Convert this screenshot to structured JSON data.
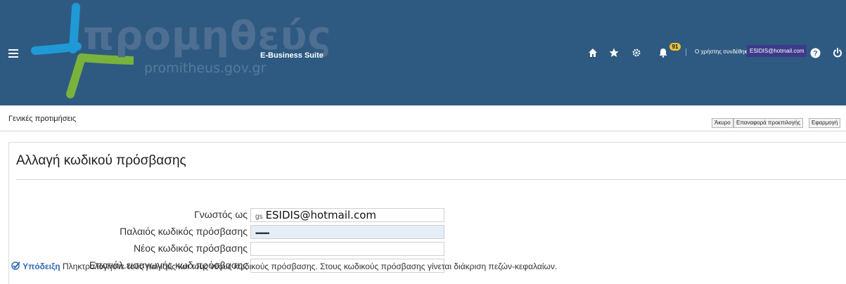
{
  "header": {
    "logo_text": "προμηθεύς",
    "logo_subtitle": "promitheus.gov.gr",
    "suite_name": "E-Business Suite",
    "notification_count": "91",
    "user_label": "Ο χρήστης συνδέθηκε",
    "user_email": "ESIDIS@hotmail.com",
    "separator": "|",
    "icons": [
      "menu-icon",
      "home-icon",
      "star-icon",
      "gear-icon",
      "bell-icon",
      "help-icon",
      "power-icon"
    ],
    "colors": {
      "header_bg": "#2e5a82",
      "logo_blue": "#1f9ad6",
      "logo_green": "#7ab33b",
      "badge": "#e6c43a"
    }
  },
  "subbar": {
    "title": "Γενικές προτιμήσεις",
    "cancel_label": "Άκυρο",
    "reset_label": "Επαναφορά προεπιλογής",
    "apply_label": "Εφαρμογή"
  },
  "form": {
    "title": "Αλλαγή κωδικού πρόσβασης",
    "fields": [
      {
        "label": "Γνωστός ως",
        "prefix": "gs",
        "value": "ESIDIS@hotmail.com"
      },
      {
        "label": "Παλαιός κωδικός πρόσβασης",
        "value": "•••••••••"
      },
      {
        "label": "Νέος κωδικός πρόσβασης",
        "value": ""
      },
      {
        "label": "Επανάλ.εισαγωγής κωδ.πρόσβασης",
        "value": ""
      }
    ],
    "hint_label": "Υπόδειξη",
    "hint_text": " Πληκτρολογήστε τους παλιούς και τους νέους κωδικούς πρόσβασης. Στους κωδικούς πρόσβασης γίνεται διάκριση πεζών-κεφαλαίων."
  }
}
